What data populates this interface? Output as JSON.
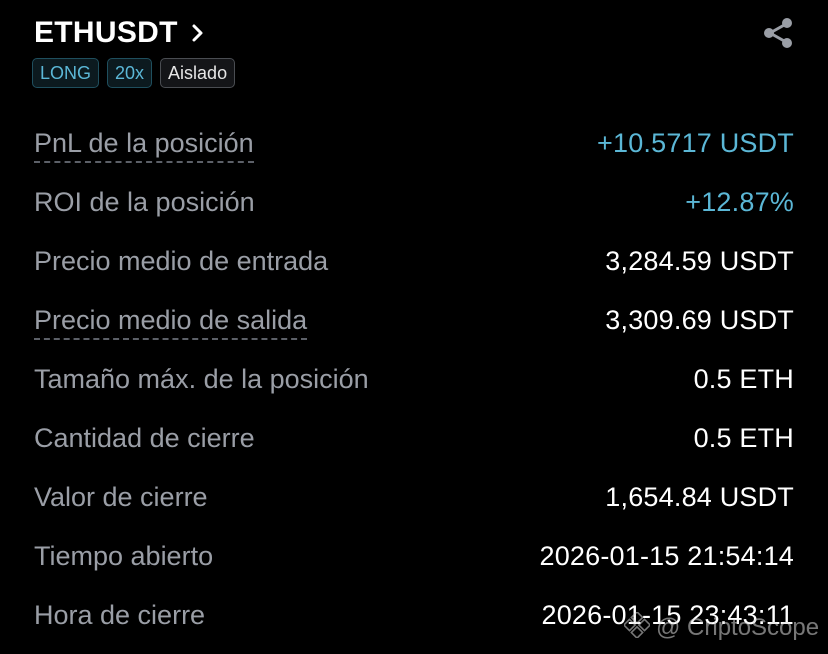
{
  "header": {
    "symbol": "ETHUSDT",
    "tags": {
      "side": "LONG",
      "leverage": "20x",
      "margin_mode": "Aislado"
    }
  },
  "details": [
    {
      "label": "PnL de la posición",
      "value": "+10.5717 USDT"
    },
    {
      "label": "ROI de la posición",
      "value": "+12.87%"
    },
    {
      "label": "Precio medio de entrada",
      "value": "3,284.59 USDT"
    },
    {
      "label": "Precio medio de salida",
      "value": "3,309.69 USDT"
    },
    {
      "label": "Tamaño máx. de la posición",
      "value": "0.5 ETH"
    },
    {
      "label": "Cantidad de cierre",
      "value": "0.5 ETH"
    },
    {
      "label": "Valor de cierre",
      "value": "1,654.84 USDT"
    },
    {
      "label": "Tiempo abierto",
      "value": "2026-01-15 21:54:14"
    },
    {
      "label": "Hora de cierre",
      "value": "2026-01-15 23:43:11"
    }
  ],
  "watermark": {
    "text": "@ CriptoScope"
  },
  "colors": {
    "background": "#000000",
    "positive": "#5bb7d6",
    "tag_accent": "#5bb7d6",
    "label": "#9a9ea6",
    "value": "#ffffff"
  },
  "icons": {
    "symbol_link": "chevron-right-icon",
    "share": "share-icon",
    "watermark_logo": "diamond-logo-icon"
  }
}
